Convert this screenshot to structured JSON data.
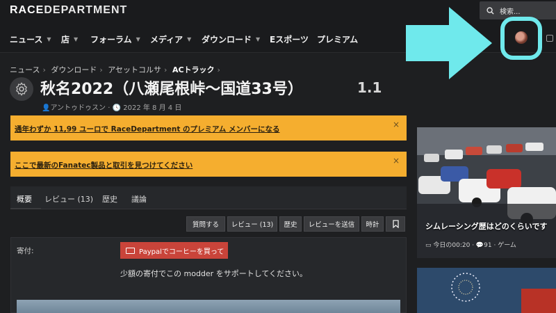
{
  "site": {
    "logo_part1": "RACE",
    "logo_part2": "DEPARTMENT",
    "search_placeholder": "検索..."
  },
  "nav": [
    {
      "label": "ニュース",
      "has_caret": true
    },
    {
      "label": "店",
      "has_caret": true
    },
    {
      "label": "フォーラム",
      "has_caret": true
    },
    {
      "label": "メディア",
      "has_caret": true
    },
    {
      "label": "ダウンロード",
      "has_caret": true
    },
    {
      "label": "Eスポーツ",
      "has_caret": false
    },
    {
      "label": "プレミアム",
      "has_caret": false
    }
  ],
  "breadcrumb": [
    "ニュース",
    "ダウンロード",
    "アセットコルサ",
    "ACトラック"
  ],
  "title": "秋名2022（八瀬尾根峠〜国道33号）",
  "version": "1.1",
  "meta": {
    "author": "アントゥドゥスン",
    "date": "2022 年 8 月 4 日"
  },
  "notices": [
    {
      "text": "通年わずか 11,99 ユーロで RaceDepartment のプレミアム メンバーになる",
      "close": "×"
    },
    {
      "text": "ここで最新のFanatec製品と取引を見つけてください",
      "close": "×"
    }
  ],
  "tabs": [
    "概要",
    "レビュー (13)",
    "歴史",
    "議論"
  ],
  "actions": [
    "質問する",
    "レビュー (13)",
    "歴史",
    "レビューを送信",
    "時計"
  ],
  "donation": {
    "label": "寄付:",
    "button": "Paypalでコーヒーを買って",
    "support": "少額の寄付でこの modder をサポートしてください。"
  },
  "sidebar": {
    "card_title": "シムレーシング歴はどのくらいです",
    "card_time": "今日の00:20",
    "card_count": "91",
    "card_category": "ゲーム"
  },
  "colors": {
    "notice_bg": "#f5ae2f",
    "annotation_cyan": "#6fe9ec",
    "paypal_red": "#c9443a",
    "background": "#1e1f21"
  }
}
